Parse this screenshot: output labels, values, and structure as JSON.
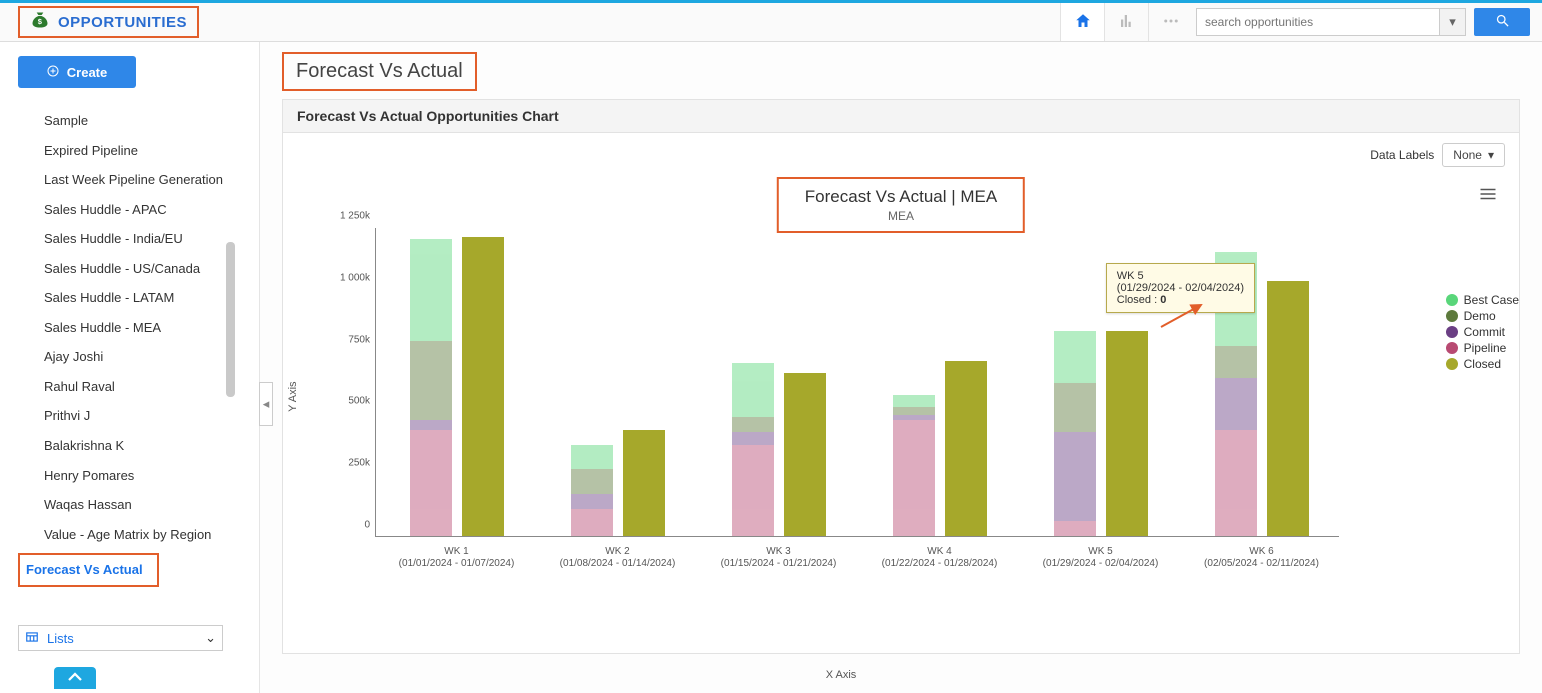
{
  "module_title": "OPPORTUNITIES",
  "search": {
    "placeholder": "search opportunities"
  },
  "sidebar": {
    "create_label": "Create",
    "items": [
      "Sample",
      "Expired Pipeline",
      "Last Week Pipeline Generation",
      "Sales Huddle - APAC",
      "Sales Huddle - India/EU",
      "Sales Huddle - US/Canada",
      "Sales Huddle - LATAM",
      "Sales Huddle - MEA",
      "Ajay Joshi",
      "Rahul Raval",
      "Prithvi J",
      "Balakrishna K",
      "Henry Pomares",
      "Waqas Hassan",
      "Value - Age Matrix by Region",
      "Forecast Vs Actual"
    ],
    "active_index": 15,
    "lists_label": "Lists"
  },
  "page_title": "Forecast Vs Actual",
  "panel_title": "Forecast Vs Actual Opportunities Chart",
  "data_labels": {
    "label": "Data Labels",
    "value": "None"
  },
  "chart_header": {
    "title": "Forecast Vs Actual | MEA",
    "subtitle": "MEA"
  },
  "tooltip": {
    "line1": "WK 5",
    "line2": "(01/29/2024 - 02/04/2024)",
    "line3_key": "Closed",
    "line3_val": "0"
  },
  "chart_data": {
    "type": "bar",
    "title": "Forecast Vs Actual | MEA",
    "subtitle": "MEA",
    "xlabel": "X Axis",
    "ylabel": "Y Axis",
    "ylim": [
      0,
      1250000
    ],
    "yticks": [
      0,
      250000,
      500000,
      750000,
      1000000,
      1250000
    ],
    "ytick_labels": [
      "0",
      "250k",
      "500k",
      "750k",
      "1 000k",
      "1 250k"
    ],
    "categories": [
      {
        "label": "WK 1",
        "range": "(01/01/2024 - 01/07/2024)"
      },
      {
        "label": "WK 2",
        "range": "(01/08/2024 - 01/14/2024)"
      },
      {
        "label": "WK 3",
        "range": "(01/15/2024 - 01/21/2024)"
      },
      {
        "label": "WK 4",
        "range": "(01/22/2024 - 01/28/2024)"
      },
      {
        "label": "WK 5",
        "range": "(01/29/2024 - 02/04/2024)"
      },
      {
        "label": "WK 6",
        "range": "(02/05/2024 - 02/11/2024)"
      }
    ],
    "legend": [
      "Best Case",
      "Demo",
      "Commit",
      "Pipeline",
      "Closed"
    ],
    "colors": {
      "Best Case": "#59d67a",
      "Demo": "#5d7a3c",
      "Commit": "#6b3f84",
      "Pipeline": "#b84a72",
      "Closed": "#a6a82b"
    },
    "stack_opacity": 0.45,
    "series_stacked": [
      {
        "name": "Pipeline",
        "values": [
          430000,
          110000,
          370000,
          470000,
          60000,
          430000
        ]
      },
      {
        "name": "Commit",
        "values": [
          40000,
          60000,
          50000,
          20000,
          360000,
          210000
        ]
      },
      {
        "name": "Demo",
        "values": [
          320000,
          100000,
          60000,
          30000,
          200000,
          130000
        ]
      },
      {
        "name": "Best Case",
        "values": [
          410000,
          100000,
          220000,
          50000,
          210000,
          380000
        ]
      }
    ],
    "series_solid": {
      "name": "Closed",
      "values": [
        1210000,
        430000,
        660000,
        710000,
        830000,
        1030000
      ]
    }
  }
}
